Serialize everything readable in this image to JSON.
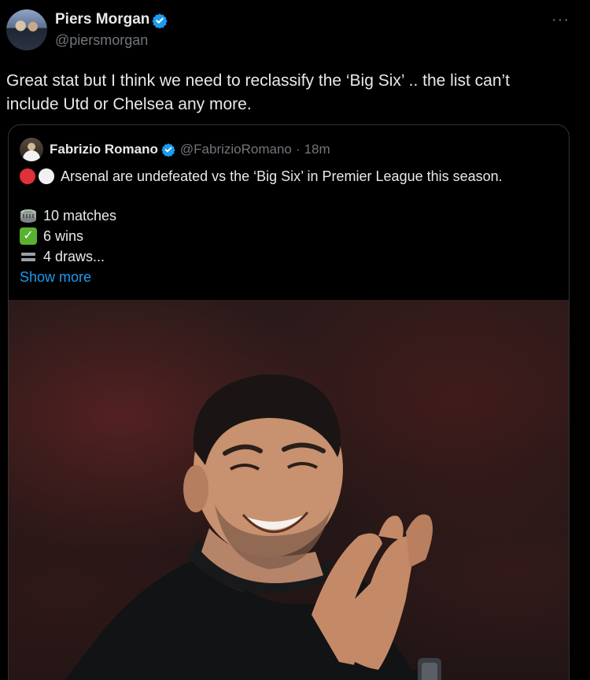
{
  "tweet": {
    "author_name": "Piers Morgan",
    "author_handle": "@piersmorgan",
    "more_label": "···",
    "text": "Great stat but I think we need to reclassify the ‘Big Six’ .. the list can’t include Utd or Chelsea any more."
  },
  "quote": {
    "author_name": "Fabrizio Romano",
    "author_handle": "@FabrizioRomano",
    "separator": "·",
    "time": "18m",
    "line1": "Arsenal are undefeated vs the ‘Big Six’ in Premier League this season.",
    "line2": "10 matches",
    "line3": "6 wins",
    "line4": "4 draws...",
    "show_more": "Show more"
  },
  "colors": {
    "verified": "#1d9bf0",
    "link": "#1d9bf0",
    "red_dot": "#e0303a",
    "check": "#58b22f"
  },
  "icons": [
    "verified-badge-icon",
    "more-options-icon",
    "red-circle-icon",
    "white-circle-icon",
    "stadium-icon",
    "check-mark-icon",
    "equals-icon"
  ]
}
